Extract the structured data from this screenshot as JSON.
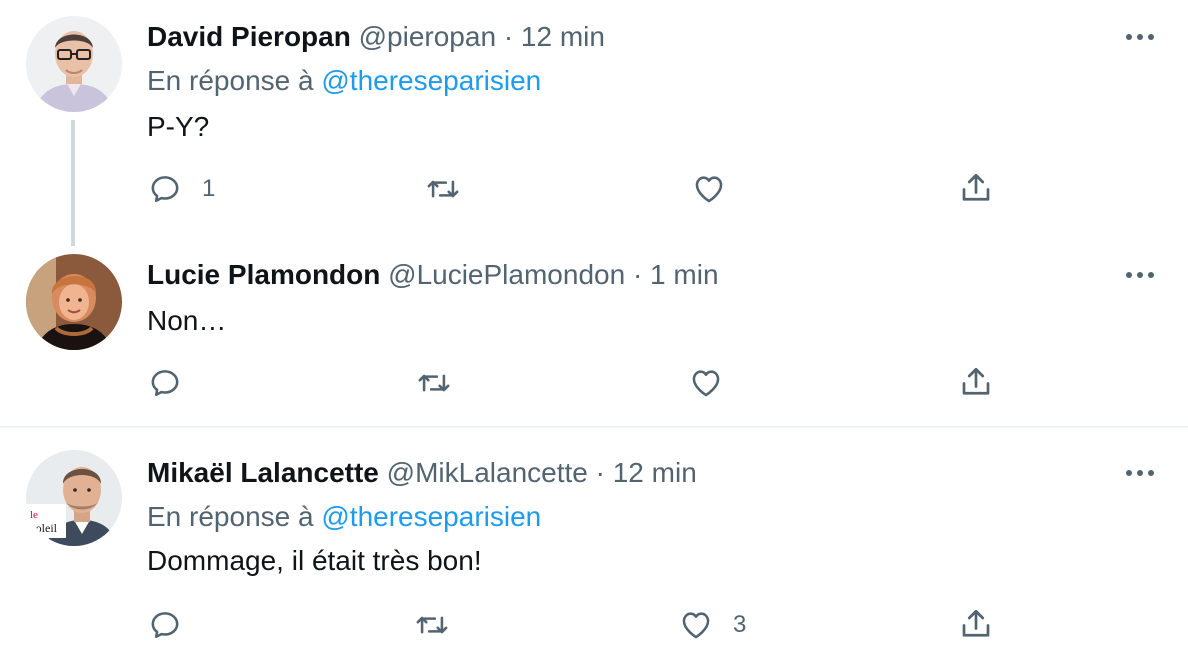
{
  "tweets": [
    {
      "name": "David Pieropan",
      "handle": "@pieropan",
      "time": "· 12 min",
      "reply_prefix": "En réponse à",
      "reply_to": "@thereseparisien",
      "text": "P-Y?",
      "reply_count": "1",
      "like_count": ""
    },
    {
      "name": "Lucie Plamondon",
      "handle": "@LuciePlamondon",
      "time": "· 1 min",
      "text": "Non…",
      "reply_count": "",
      "like_count": ""
    },
    {
      "name": "Mikaël Lalancette",
      "handle": "@MikLalancette",
      "time": "· 12 min",
      "reply_prefix": "En réponse à",
      "reply_to": "@thereseparisien",
      "text": "Dommage, il était très bon!",
      "reply_count": "",
      "like_count": "3",
      "avatar_badge": "le Soleil"
    }
  ],
  "icons": {
    "reply": "reply-icon",
    "retweet": "retweet-icon",
    "like": "heart-icon",
    "share": "share-icon",
    "more": "more-icon"
  },
  "colors": {
    "text": "#0f1419",
    "secondary": "#536471",
    "mention": "#1d9bf0",
    "thread_line": "#cfd9de",
    "divider": "#eff3f4"
  }
}
